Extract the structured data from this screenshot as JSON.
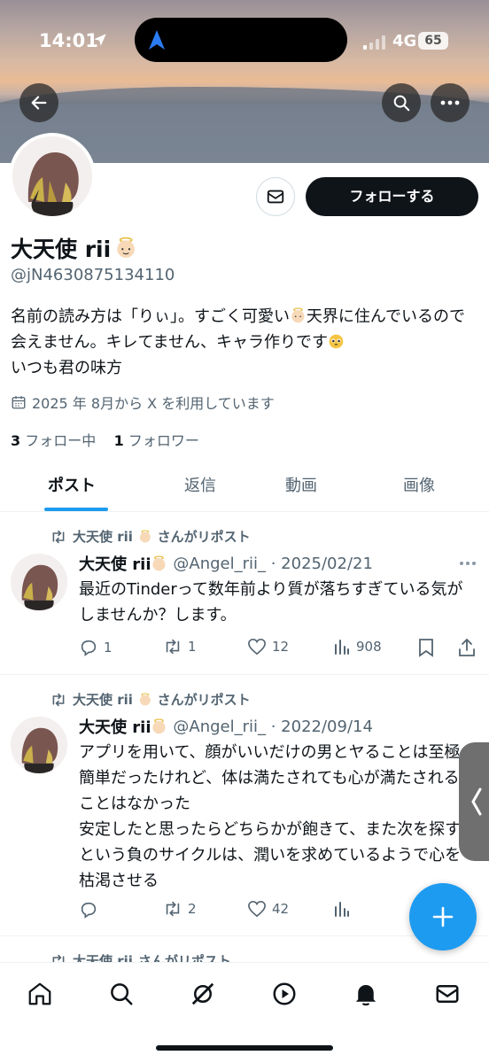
{
  "status_bar": {
    "time": "14:01",
    "network": "4G",
    "battery": "65"
  },
  "profile": {
    "name": "大天使 rii",
    "handle": "@jN4630875134110",
    "follow_button": "フォローする",
    "bio": "名前の読み方は「りぃ」。すごく可愛い",
    "bio_2": "天界に住んでいるので会えません。キレてません、キャラ作りです",
    "bio_3": "いつも君の味方",
    "joined": "2025 年 8月から X を利用しています",
    "following_count": "3",
    "following_label": "フォロー中",
    "followers_count": "1",
    "followers_label": "フォロワー"
  },
  "tabs": [
    {
      "label": "ポスト",
      "active": true
    },
    {
      "label": "返信",
      "active": false
    },
    {
      "label": "動画",
      "active": false
    },
    {
      "label": "画像",
      "active": false
    }
  ],
  "posts": [
    {
      "repost_label": "大天使 rii",
      "repost_suffix": "さんがリポスト",
      "author": "大天使 rii",
      "handle_date": "@Angel_rii_ · 2025/02/21",
      "text": "最近のTinderって数年前より質が落ちすぎている気がしませんか？します。",
      "replies": "1",
      "reposts": "1",
      "likes": "12",
      "views": "908"
    },
    {
      "repost_label": "大天使 rii",
      "repost_suffix": "さんがリポスト",
      "author": "大天使 rii",
      "handle_date": "@Angel_rii_ · 2022/09/14",
      "text": "アプリを用いて、顔がいいだけの男とヤることは至極簡単だったけれど、体は満たされても心が満たされることはなかった\n安定したと思ったらどちらかが飽きて、また次を探すという負のサイクルは、潤いを求めているようで心を枯渇させる",
      "replies": "",
      "reposts": "2",
      "likes": "42",
      "views": ""
    },
    {
      "repost_label": "大天使 rii",
      "repost_suffix": "さんがリポスト"
    }
  ],
  "colors": {
    "accent": "#1d9bf0",
    "text": "#0f1419",
    "muted": "#536471"
  }
}
